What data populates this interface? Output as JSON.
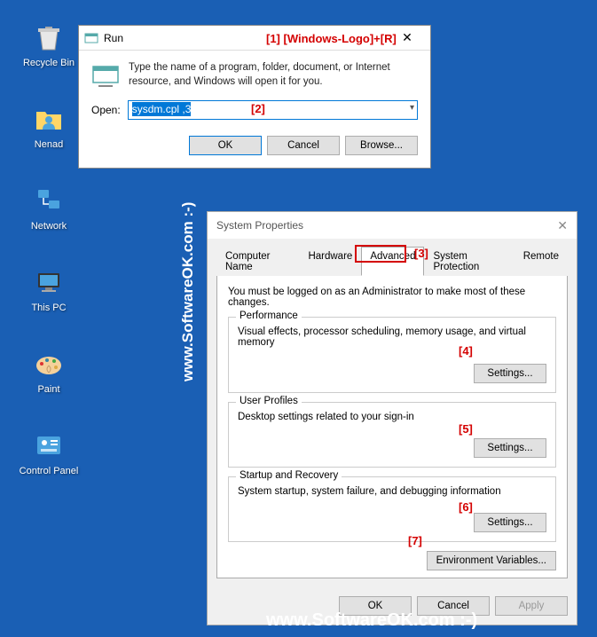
{
  "desktop": {
    "icons": [
      {
        "name": "recycle-bin",
        "label": "Recycle Bin"
      },
      {
        "name": "user-folder",
        "label": "Nenad"
      },
      {
        "name": "network",
        "label": "Network"
      },
      {
        "name": "this-pc",
        "label": "This PC"
      },
      {
        "name": "paint",
        "label": "Paint"
      },
      {
        "name": "control-panel",
        "label": "Control Panel"
      }
    ]
  },
  "run": {
    "title": "Run",
    "description": "Type the name of a program, folder, document, or Internet resource, and Windows will open it for you.",
    "open_label": "Open:",
    "input_value": "sysdm.cpl ,3",
    "ok": "OK",
    "cancel": "Cancel",
    "browse": "Browse..."
  },
  "sysprop": {
    "title": "System Properties",
    "tabs": {
      "computer_name": "Computer Name",
      "hardware": "Hardware",
      "advanced": "Advanced",
      "system_protection": "System Protection",
      "remote": "Remote"
    },
    "admin_note": "You must be logged on as an Administrator to make most of these changes.",
    "performance": {
      "legend": "Performance",
      "desc": "Visual effects, processor scheduling, memory usage, and virtual memory",
      "settings": "Settings..."
    },
    "user_profiles": {
      "legend": "User Profiles",
      "desc": "Desktop settings related to your sign-in",
      "settings": "Settings..."
    },
    "startup": {
      "legend": "Startup and Recovery",
      "desc": "System startup, system failure, and debugging information",
      "settings": "Settings..."
    },
    "env_vars": "Environment Variables...",
    "ok": "OK",
    "cancel": "Cancel",
    "apply": "Apply"
  },
  "annotations": {
    "a1": "[1]  [Windows-Logo]+[R]",
    "a2": "[2]",
    "a3": "[3]",
    "a4": "[4]",
    "a5": "[5]",
    "a6": "[6]",
    "a7": "[7]"
  },
  "watermark": "www.SoftwareOK.com :-)"
}
